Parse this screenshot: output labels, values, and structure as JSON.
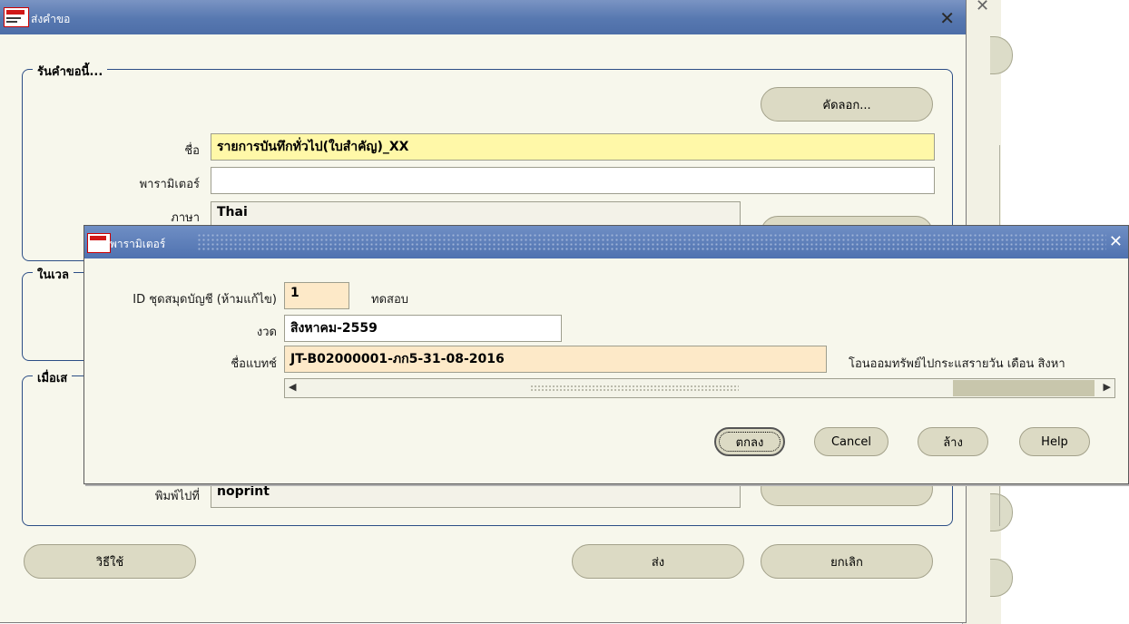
{
  "main_window": {
    "title": "ส่งคำขอ",
    "group_request": {
      "legend": "รันคำขอนี้...",
      "copy_button": "คัดลอก...",
      "name_label": "ชื่อ",
      "name_value": "รายการบันทึกทั่วไป(ใบสำคัญ)_XX",
      "params_label": "พารามิเตอร์",
      "params_value": "",
      "language_label": "ภาษา",
      "language_value": "Thai"
    },
    "group_time": {
      "legend": "ในเวล"
    },
    "group_finish": {
      "legend": "เมื่อเส",
      "print_to_label": "พิมพ์ไปที่",
      "print_to_value": "noprint"
    },
    "help_button": "วิธีใช้",
    "submit_button": "ส่ง",
    "cancel_button": "ยกเลิก"
  },
  "dialog": {
    "title": "พารามิเตอร์",
    "ledger_label": "ID ชุดสมุดบัญชี (ห้ามแก้ไข)",
    "ledger_value": "1",
    "ledger_desc": "ทดสอบ",
    "period_label": "งวด",
    "period_value": "สิงหาคม-2559",
    "batch_label": "ชื่อแบทช์",
    "batch_value": "JT-B02000001-ภก5-31-08-2016",
    "batch_desc": "โอนออมทรัพย์ไปกระแสรายวัน เดือน สิงหา",
    "ok_button": "ตกลง",
    "cancel_button": "Cancel",
    "clear_button": "ล้าง",
    "help_button": "Help"
  },
  "colors": {
    "titlebar": "#5778b0",
    "required_field": "#fff8a8",
    "readonly_field": "#fde9c8",
    "window_bg": "#f7f7ec"
  }
}
